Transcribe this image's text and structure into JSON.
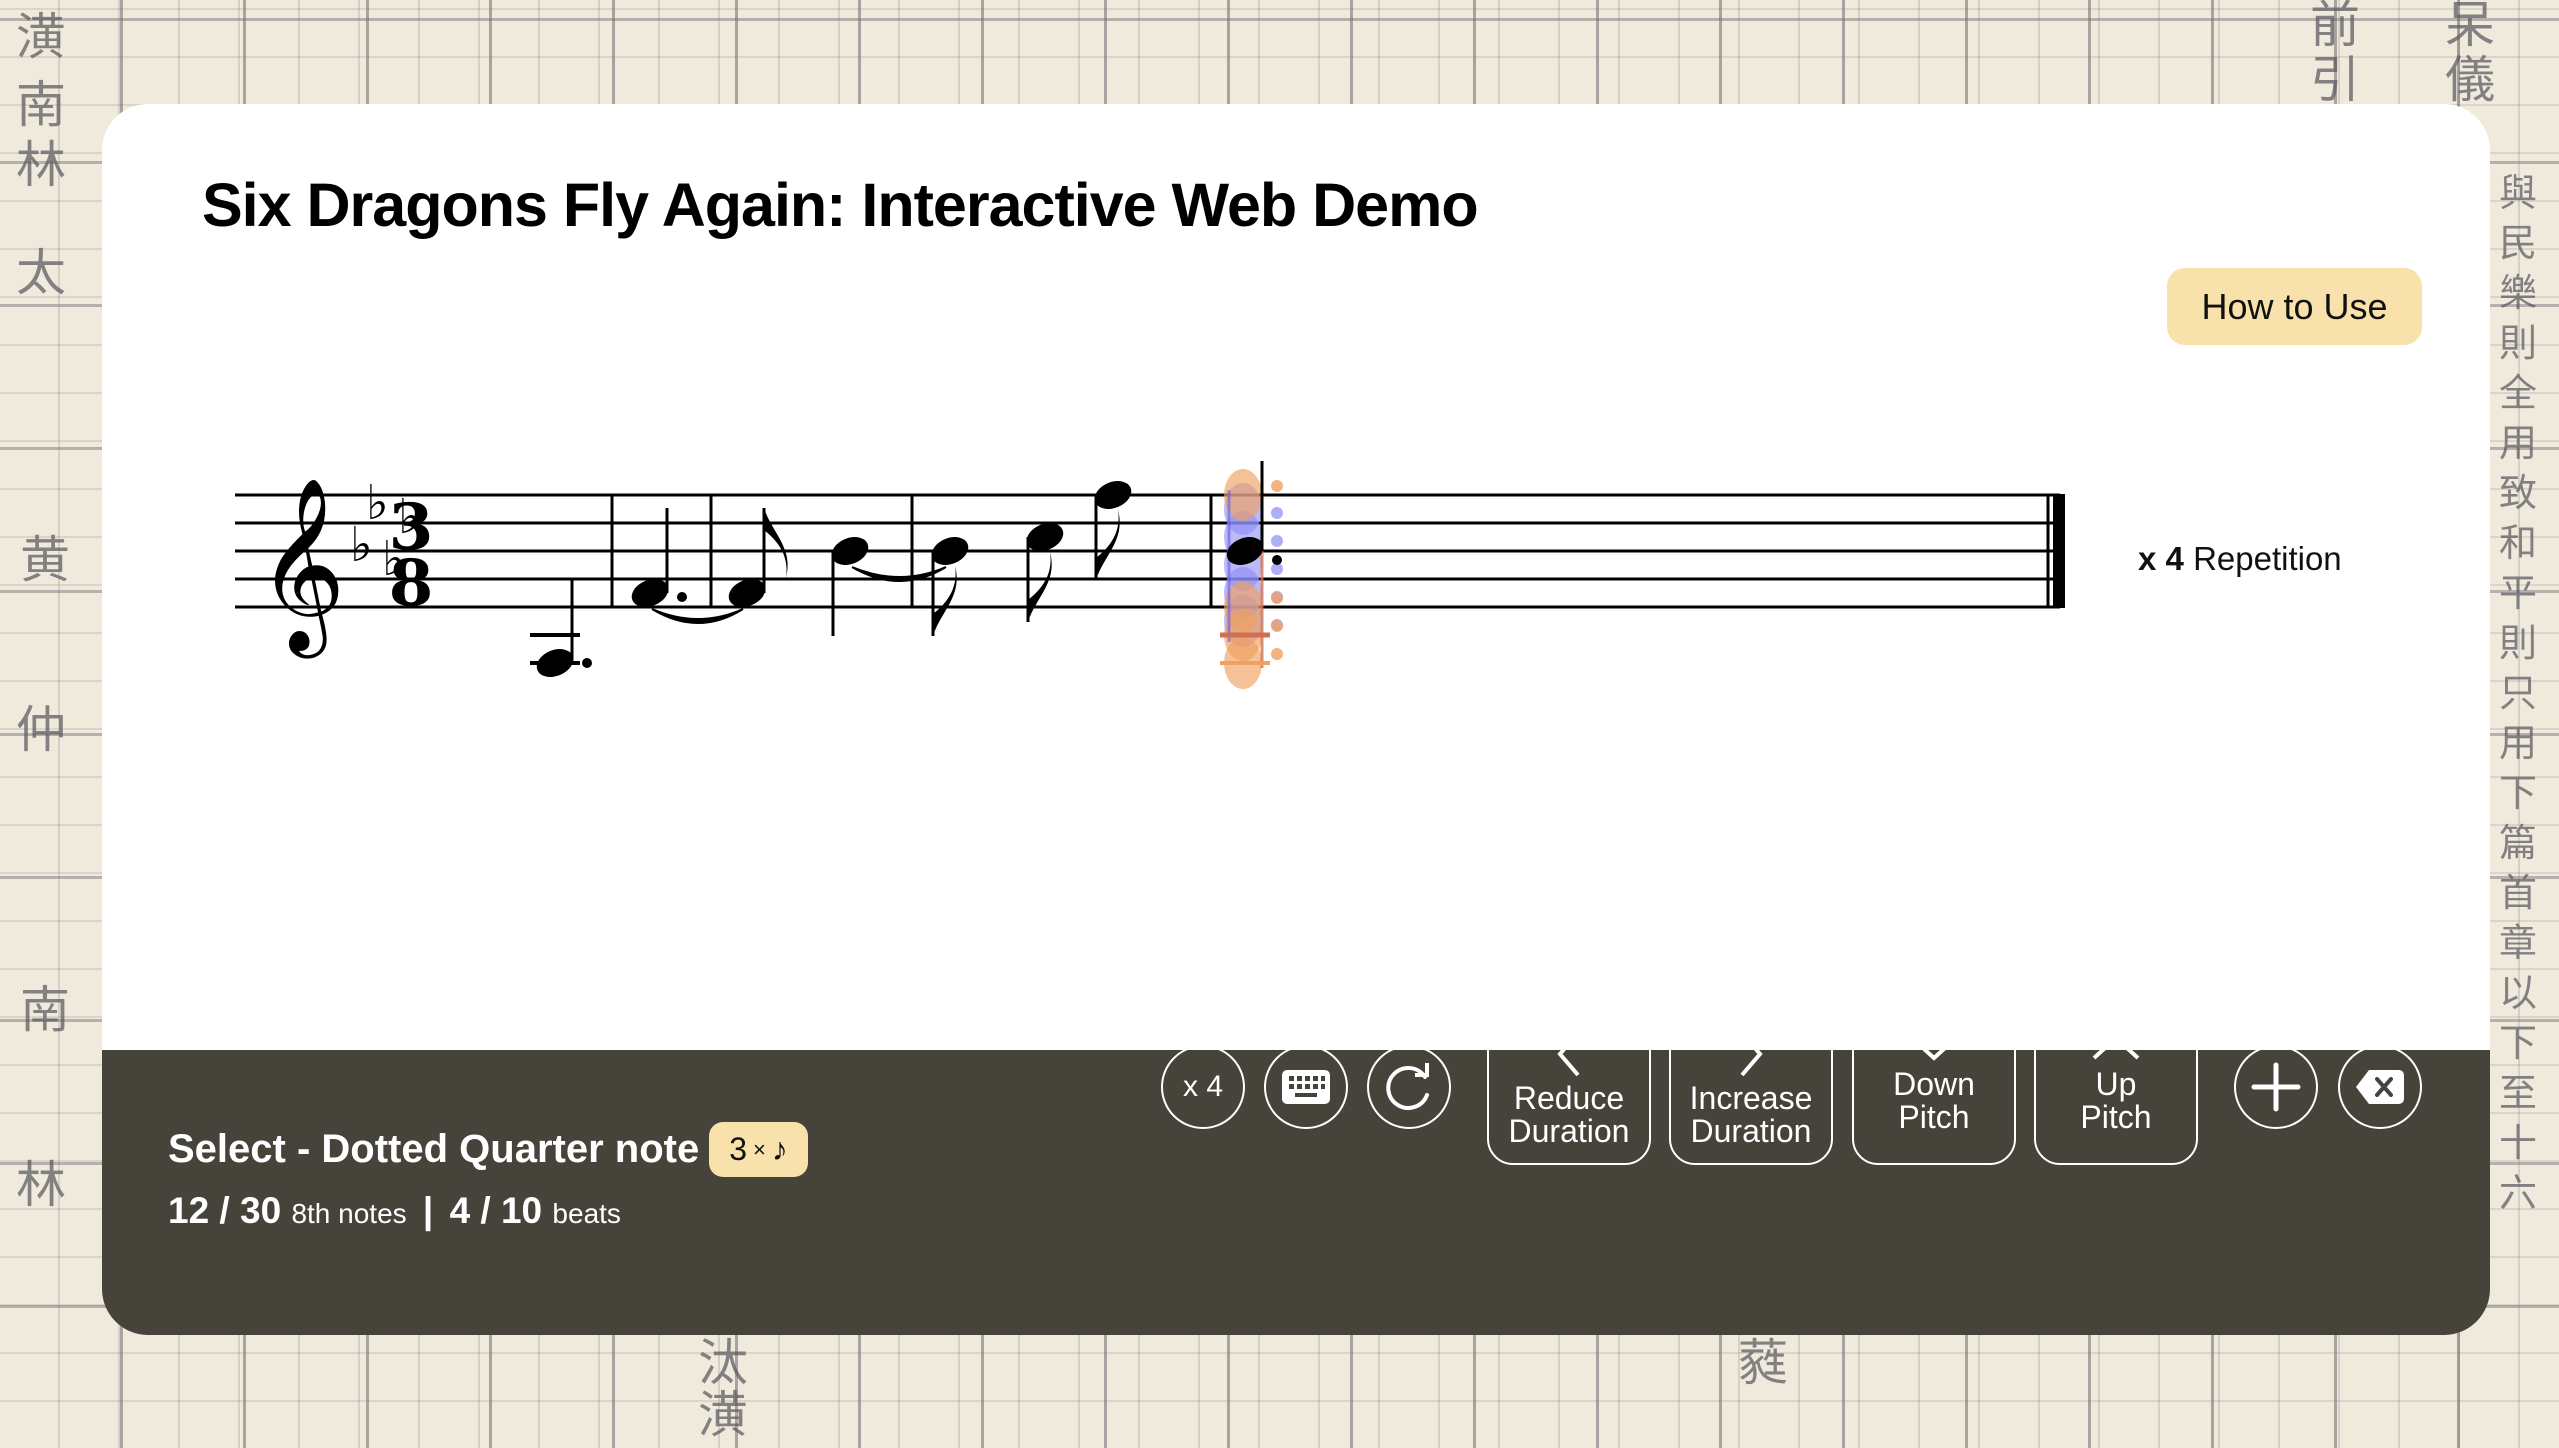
{
  "background": {
    "characters_left": [
      "潢",
      "南",
      "林",
      "太",
      "黄",
      "仲",
      "南",
      "林"
    ],
    "characters_right_column": "與民樂則全用致和平則只用下篇首章以下至十六",
    "characters_top_right": [
      "前",
      "引",
      "呆",
      "儀"
    ],
    "characters_bottom": [
      "汰",
      "潢",
      "蕤"
    ]
  },
  "header": {
    "title": "Six Dragons Fly Again: Interactive Web Demo",
    "how_to_use_label": "How to Use"
  },
  "repetition": {
    "prefix": "x",
    "count": "4",
    "label": "Repetition"
  },
  "score": {
    "clef": "treble",
    "key_signature": {
      "flats": 4,
      "name": "A-flat major / F minor"
    },
    "time_signature": {
      "numerator": "3",
      "denominator": "8"
    },
    "measures": [
      {
        "notes": [
          {
            "pitch": "A3",
            "duration": "dotted-quarter",
            "eighths": 3
          }
        ]
      },
      {
        "notes": [
          {
            "pitch": "F4",
            "duration": "dotted-quarter",
            "eighths": 3,
            "tie_to_next": true
          }
        ]
      },
      {
        "notes": [
          {
            "pitch": "F4",
            "duration": "eighth",
            "eighths": 1
          },
          {
            "pitch": "B4",
            "duration": "quarter",
            "eighths": 2,
            "tie_to_next": true
          }
        ]
      },
      {
        "notes": [
          {
            "pitch": "B4",
            "duration": "eighth",
            "eighths": 1
          },
          {
            "pitch": "C5",
            "duration": "eighth",
            "eighths": 1
          },
          {
            "pitch": "F5",
            "duration": "eighth",
            "eighths": 1
          }
        ]
      },
      {
        "notes": [
          {
            "pitch": "B4",
            "duration": "dotted-quarter",
            "eighths": 3,
            "selected": true
          }
        ]
      }
    ],
    "selection_candidates": {
      "orange": [
        "F5",
        "E4",
        "C4",
        "A3"
      ],
      "blue": [
        "E5",
        "C5",
        "A4",
        "F4",
        "D4"
      ]
    },
    "final_barline": "end"
  },
  "status": {
    "mode_label": "Select - Dotted Quarter note",
    "badge": {
      "count": "3",
      "times": "×",
      "symbol": "♪"
    },
    "eighths_current": "12",
    "eighths_total": "30",
    "eighths_unit": "8th notes",
    "separator": "|",
    "beats_current": "4",
    "beats_total": "10",
    "beats_unit": "beats"
  },
  "toolbar": {
    "repeat_button_label": "x 4",
    "keyboard_icon": "keyboard-icon",
    "redo_icon": "rotate-clockwise-icon",
    "reduce_duration_label": "Reduce\nDuration",
    "increase_duration_label": "Increase\nDuration",
    "down_pitch_label": "Down\nPitch",
    "up_pitch_label": "Up\nPitch",
    "add_icon": "plus-icon",
    "delete_icon": "backspace-icon"
  },
  "colors": {
    "toolbar_bg": "#46433b",
    "accent_badge": "#f8e1aa",
    "select_orange": "#f0a060",
    "select_blue": "#8c8cf5"
  }
}
